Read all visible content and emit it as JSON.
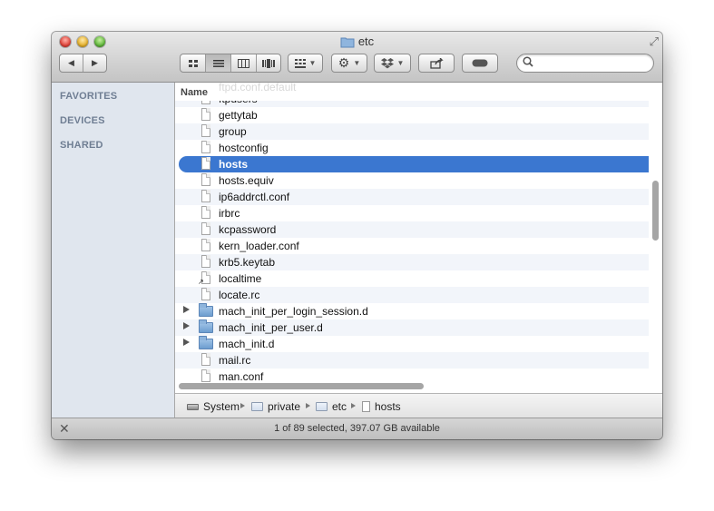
{
  "window": {
    "title": "etc"
  },
  "toolbar": {
    "back": "◀",
    "forward": "▶",
    "view_icons": "icons",
    "view_list": "list",
    "view_columns": "columns",
    "view_coverflow": "coverflow",
    "arrange_icon": "arrange-grid-icon",
    "action_icon": "gear-icon",
    "dropbox_icon": "dropbox-icon",
    "share_icon": "share-icon",
    "toggle_icon": "toggle-icon",
    "search_placeholder": ""
  },
  "sidebar": {
    "sections": [
      "FAVORITES",
      "DEVICES",
      "SHARED"
    ]
  },
  "list": {
    "header": "Name",
    "ghost_text": "ftpd.conf.default",
    "items": [
      {
        "name": "ftpusers",
        "kind": "file"
      },
      {
        "name": "gettytab",
        "kind": "file"
      },
      {
        "name": "group",
        "kind": "file"
      },
      {
        "name": "hostconfig",
        "kind": "file"
      },
      {
        "name": "hosts",
        "kind": "file",
        "selected": true
      },
      {
        "name": "hosts.equiv",
        "kind": "file"
      },
      {
        "name": "ip6addrctl.conf",
        "kind": "file"
      },
      {
        "name": "irbrc",
        "kind": "file"
      },
      {
        "name": "kcpassword",
        "kind": "file"
      },
      {
        "name": "kern_loader.conf",
        "kind": "file"
      },
      {
        "name": "krb5.keytab",
        "kind": "file"
      },
      {
        "name": "localtime",
        "kind": "alias"
      },
      {
        "name": "locate.rc",
        "kind": "file"
      },
      {
        "name": "mach_init_per_login_session.d",
        "kind": "folder"
      },
      {
        "name": "mach_init_per_user.d",
        "kind": "folder"
      },
      {
        "name": "mach_init.d",
        "kind": "folder"
      },
      {
        "name": "mail.rc",
        "kind": "file"
      },
      {
        "name": "man.conf",
        "kind": "file"
      }
    ]
  },
  "pathbar": {
    "crumbs": [
      {
        "label": "System",
        "icon": "disk-icon"
      },
      {
        "label": "private",
        "icon": "folder-icon"
      },
      {
        "label": "etc",
        "icon": "folder-icon"
      },
      {
        "label": "hosts",
        "icon": "document-icon"
      }
    ]
  },
  "status": {
    "text": "1 of 89 selected, 397.07 GB available"
  }
}
